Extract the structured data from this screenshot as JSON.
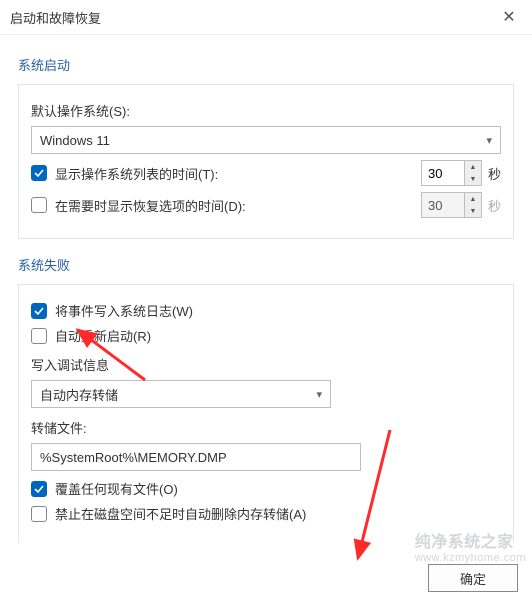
{
  "window": {
    "title": "启动和故障恢复"
  },
  "systemStartup": {
    "groupLabel": "系统启动",
    "defaultOSLabel": "默认操作系统(S):",
    "defaultOSValue": "Windows 11",
    "showOSListLabel": "显示操作系统列表的时间(T):",
    "showOSListChecked": true,
    "showOSListSeconds": "30",
    "showRecoveryLabel": "在需要时显示恢复选项的时间(D):",
    "showRecoveryChecked": false,
    "showRecoverySeconds": "30",
    "secondsUnit": "秒"
  },
  "systemFailure": {
    "groupLabel": "系统失败",
    "writeEventLabel": "将事件写入系统日志(W)",
    "writeEventChecked": true,
    "autoRestartLabel": "自动重新启动(R)",
    "autoRestartChecked": false,
    "debugInfoLabel": "写入调试信息",
    "dumpTypeValue": "自动内存转储",
    "dumpFileLabel": "转储文件:",
    "dumpFileValue": "%SystemRoot%\\MEMORY.DMP",
    "overwriteLabel": "覆盖任何现有文件(O)",
    "overwriteChecked": true,
    "disableLowSpaceLabel": "禁止在磁盘空间不足时自动删除内存转储(A)",
    "disableLowSpaceChecked": false
  },
  "buttons": {
    "ok": "确定"
  },
  "watermark": {
    "text": "纯净系统之家",
    "url": "www.kzmyhome.com"
  }
}
